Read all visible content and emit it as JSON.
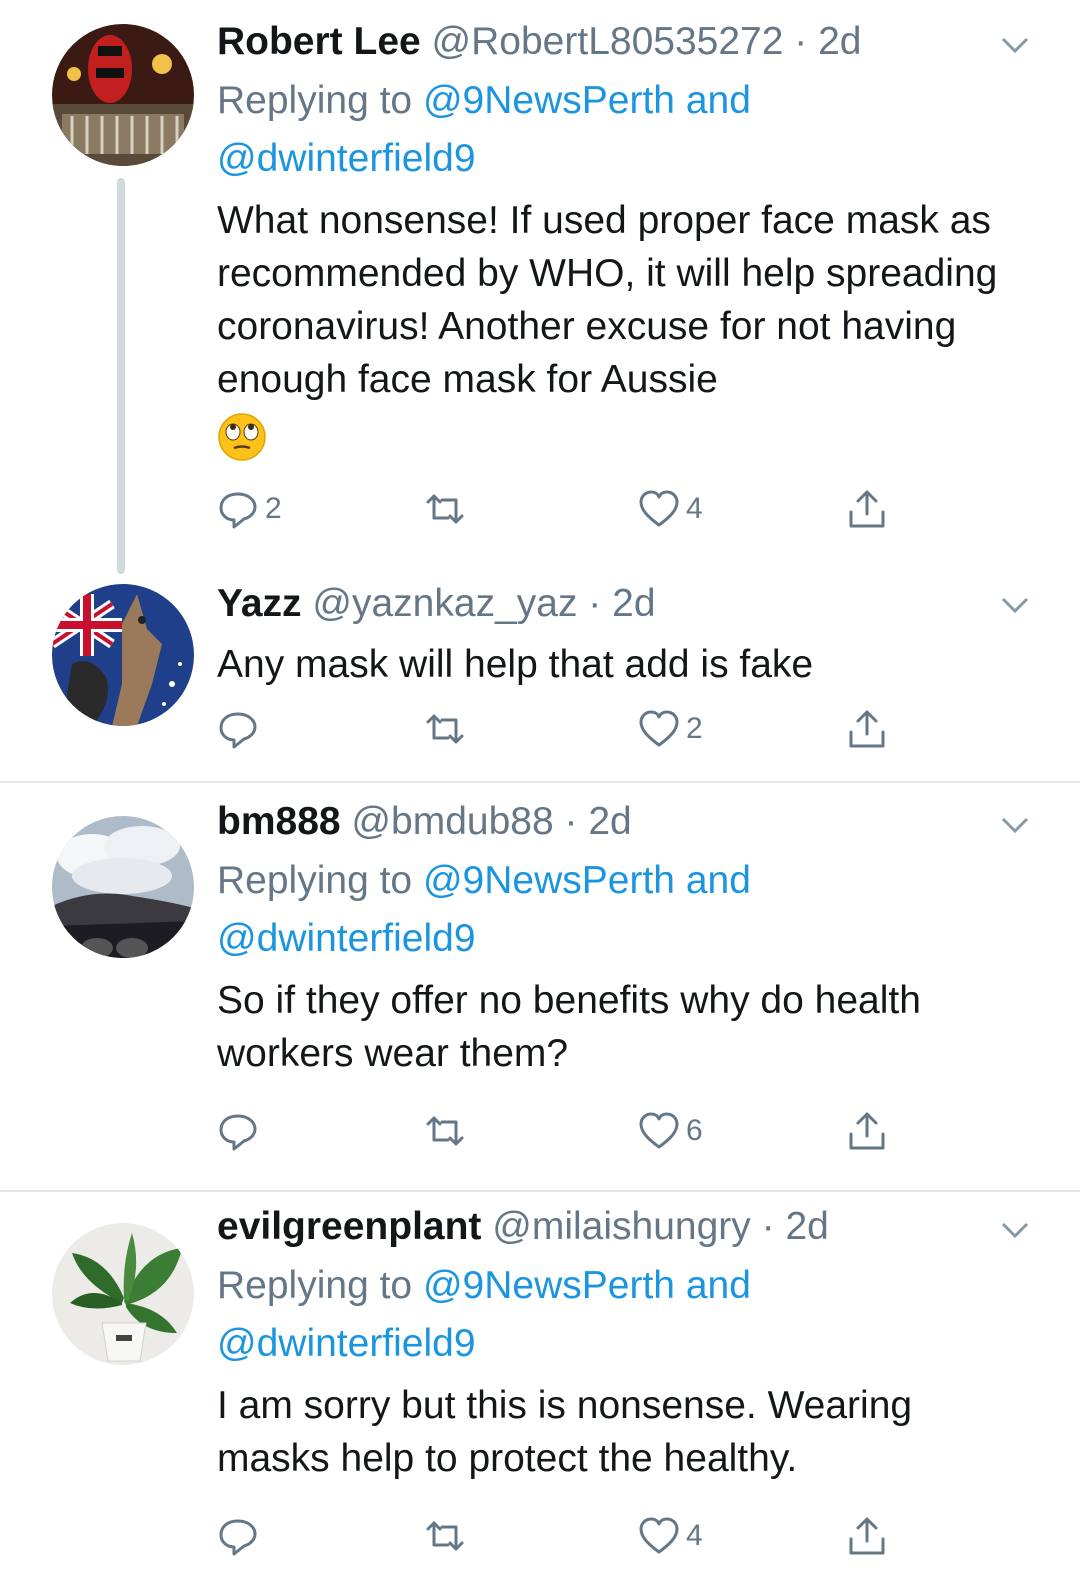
{
  "tweets": [
    {
      "name": "Robert Lee",
      "handle": "@RobertL80535272",
      "dot": "·",
      "time": "2d",
      "replying_prefix": "Replying to",
      "replying_to_1": "@9NewsPerth and",
      "replying_to_2": "@dwinterfield9",
      "body": "What nonsense! If used proper face mask as recommended by WHO, it will help spreading coronavirus! Another excuse for not having enough face mask for Aussie",
      "emoji": "eye-roll-emoji",
      "reply_count": "2",
      "retweet_count": "",
      "like_count": "4"
    },
    {
      "name": "Yazz",
      "handle": "@yaznkaz_yaz",
      "dot": "·",
      "time": "2d",
      "body": "Any mask will help that add is fake",
      "reply_count": "",
      "retweet_count": "",
      "like_count": "2"
    },
    {
      "name": "bm888",
      "handle": "@bmdub88",
      "dot": "·",
      "time": "2d",
      "replying_prefix": "Replying to",
      "replying_to_1": "@9NewsPerth and",
      "replying_to_2": "@dwinterfield9",
      "body": "So if they offer no benefits why do health workers wear them?",
      "reply_count": "",
      "retweet_count": "",
      "like_count": "6"
    },
    {
      "name": "evilgreenplant",
      "handle": "@milaishungry",
      "dot": "·",
      "time": "2d",
      "replying_prefix": "Replying to",
      "replying_to_1": "@9NewsPerth and",
      "replying_to_2": "@dwinterfield9",
      "body": "I am sorry but this is nonsense. Wearing masks help to protect the healthy.",
      "reply_count": "",
      "retweet_count": "",
      "like_count": "4"
    }
  ],
  "colors": {
    "text": "#14171a",
    "secondary": "#657786",
    "link": "#1b95e0",
    "divider": "#e1e8ed"
  },
  "icons": [
    "reply-icon",
    "retweet-icon",
    "like-icon",
    "share-icon",
    "caret-down-icon"
  ]
}
